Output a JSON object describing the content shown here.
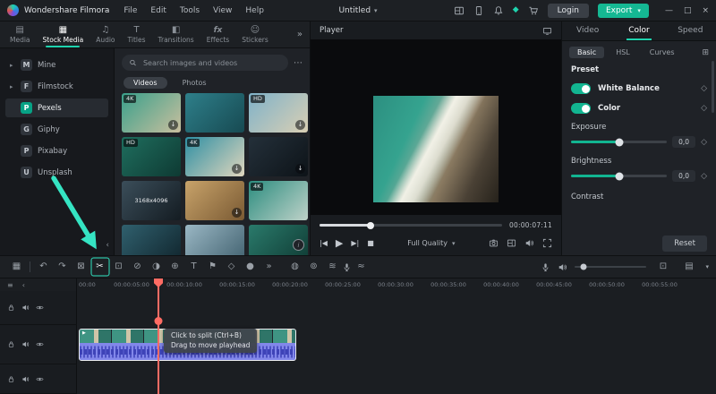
{
  "colors": {
    "accent": "#15b893",
    "playhead": "#ff6c64",
    "clip": "#8287ea",
    "annotation": "#35e4c3"
  },
  "icons": {
    "caret_down": "▾",
    "minimize": "—",
    "maximize": "□",
    "close": "×",
    "gem": "◆",
    "dots": "⋯",
    "double_chevron": "»",
    "chevron_left": "‹",
    "info": "i",
    "prev": "|◀",
    "play": "▶",
    "next": "▶|",
    "stop": "■",
    "diamond": "◇",
    "save_preset": "⊞",
    "fit": "⊡",
    "tracks": "▤",
    "download": "↓",
    "manage": "≡"
  },
  "menubar": {
    "app_name": "Wondershare Filmora",
    "menus": [
      "File",
      "Edit",
      "Tools",
      "View",
      "Help"
    ],
    "project_title": "Untitled",
    "login_label": "Login",
    "export_label": "Export"
  },
  "media_tabs": [
    {
      "label": "Media",
      "glyph": "▤",
      "active": false
    },
    {
      "label": "Stock Media",
      "glyph": "▦",
      "active": true
    },
    {
      "label": "Audio",
      "glyph": "♫",
      "active": false
    },
    {
      "label": "Titles",
      "glyph": "T",
      "active": false
    },
    {
      "label": "Transitions",
      "glyph": "◧",
      "active": false
    },
    {
      "label": "Effects",
      "glyph": "fx",
      "active": false
    },
    {
      "label": "Stickers",
      "glyph": "☺",
      "active": false
    }
  ],
  "sidebar": {
    "items": [
      {
        "label": "Mine",
        "abbr": "M",
        "expandable": true,
        "active": false
      },
      {
        "label": "Filmstock",
        "abbr": "F",
        "expandable": true,
        "active": false
      },
      {
        "label": "Pexels",
        "abbr": "P",
        "expandable": false,
        "active": true
      },
      {
        "label": "Giphy",
        "abbr": "G",
        "expandable": false,
        "active": false
      },
      {
        "label": "Pixabay",
        "abbr": "P",
        "expandable": false,
        "active": false
      },
      {
        "label": "Unsplash",
        "abbr": "U",
        "expandable": false,
        "active": false
      }
    ]
  },
  "browser": {
    "search_placeholder": "Search images and videos",
    "tabs": [
      {
        "label": "Videos",
        "active": true
      },
      {
        "label": "Photos",
        "active": false
      }
    ],
    "thumbs": [
      {
        "badge": "4K",
        "dl": true,
        "center": "",
        "c1": "#3aa08b",
        "c2": "#c9bf9e"
      },
      {
        "badge": "",
        "dl": false,
        "center": "",
        "c1": "#2e7f8a",
        "c2": "#174a52"
      },
      {
        "badge": "HD",
        "dl": true,
        "center": "",
        "c1": "#7fb2c9",
        "c2": "#d9cfb4"
      },
      {
        "badge": "HD",
        "dl": false,
        "center": "",
        "c1": "#1f6e5e",
        "c2": "#0e3a33"
      },
      {
        "badge": "4K",
        "dl": true,
        "center": "",
        "c1": "#2f8fa3",
        "c2": "#e0d6bd"
      },
      {
        "badge": "",
        "dl": true,
        "center": "",
        "c1": "#24303a",
        "c2": "#0d1318"
      },
      {
        "badge": "",
        "dl": false,
        "center": "3168x4096",
        "c1": "#3b4e5a",
        "c2": "#141c22"
      },
      {
        "badge": "",
        "dl": true,
        "center": "",
        "c1": "#c8a36a",
        "c2": "#7a5a33"
      },
      {
        "badge": "4K",
        "dl": false,
        "center": "",
        "c1": "#2c8d7f",
        "c2": "#bfd2c9"
      },
      {
        "badge": "",
        "dl": false,
        "center": "",
        "c1": "#30606e",
        "c2": "#10242c"
      },
      {
        "badge": "",
        "dl": false,
        "center": "",
        "c1": "#9ab7c4",
        "c2": "#40606e"
      },
      {
        "badge": "",
        "dl": false,
        "center": "",
        "c1": "#2a7a6b",
        "c2": "#0f3a33"
      }
    ]
  },
  "player": {
    "title": "Player",
    "timecode": "00:00:07:11",
    "quality_label": "Full Quality"
  },
  "properties": {
    "tabs": [
      {
        "label": "Video",
        "active": false
      },
      {
        "label": "Color",
        "active": true
      },
      {
        "label": "Speed",
        "active": false
      }
    ],
    "subtabs": [
      {
        "label": "Basic",
        "active": true
      },
      {
        "label": "HSL",
        "active": false
      },
      {
        "label": "Curves",
        "active": false
      }
    ],
    "preset_label": "Preset",
    "toggles": [
      {
        "label": "White Balance",
        "on": true
      },
      {
        "label": "Color",
        "on": true
      }
    ],
    "sliders": [
      {
        "label": "Exposure",
        "value": "0,0"
      },
      {
        "label": "Brightness",
        "value": "0,0"
      }
    ],
    "next_label": "Contrast",
    "reset_label": "Reset"
  },
  "toolbar": {
    "left_icons": [
      {
        "name": "media-view-icon",
        "glyph": "▦"
      },
      {
        "name": "undo-icon",
        "glyph": "↶"
      },
      {
        "name": "redo-icon",
        "glyph": "↷"
      },
      {
        "name": "delete-icon",
        "glyph": "⊠"
      },
      {
        "name": "split-icon",
        "glyph": "✂",
        "highlight": true
      },
      {
        "name": "crop-icon",
        "glyph": "⊡"
      },
      {
        "name": "speed-ramping-icon",
        "glyph": "⊘"
      },
      {
        "name": "color-correction-icon",
        "glyph": "◑"
      },
      {
        "name": "green-screen-icon",
        "glyph": "⊕"
      },
      {
        "name": "text-tool-icon",
        "glyph": "T"
      },
      {
        "name": "marker-icon",
        "glyph": "⚑"
      },
      {
        "name": "keyframe-icon",
        "glyph": "◇"
      },
      {
        "name": "record-icon",
        "glyph": "●"
      },
      {
        "name": "more-tools-icon",
        "glyph": "»"
      }
    ],
    "mid_icons": [
      {
        "name": "mask-icon",
        "glyph": "◍"
      },
      {
        "name": "motion-tracking-icon",
        "glyph": "⊚"
      },
      {
        "name": "audio-mixer-icon",
        "glyph": "≋"
      },
      {
        "name": "voiceover-icon",
        "svg": "i-mic"
      },
      {
        "name": "audio-stretch-icon",
        "glyph": "≈"
      }
    ]
  },
  "timeline": {
    "ruler": [
      "00:00",
      "00:00:05:00",
      "00:00:10:00",
      "00:00:15:00",
      "00:00:20:00",
      "00:00:25:00",
      "00:00:30:00",
      "00:00:35:00",
      "00:00:40:00",
      "00:00:45:00",
      "00:00:50:00",
      "00:00:55:00"
    ],
    "tooltip": [
      "Click to split (Ctrl+B)",
      "Drag to move playhead"
    ]
  }
}
